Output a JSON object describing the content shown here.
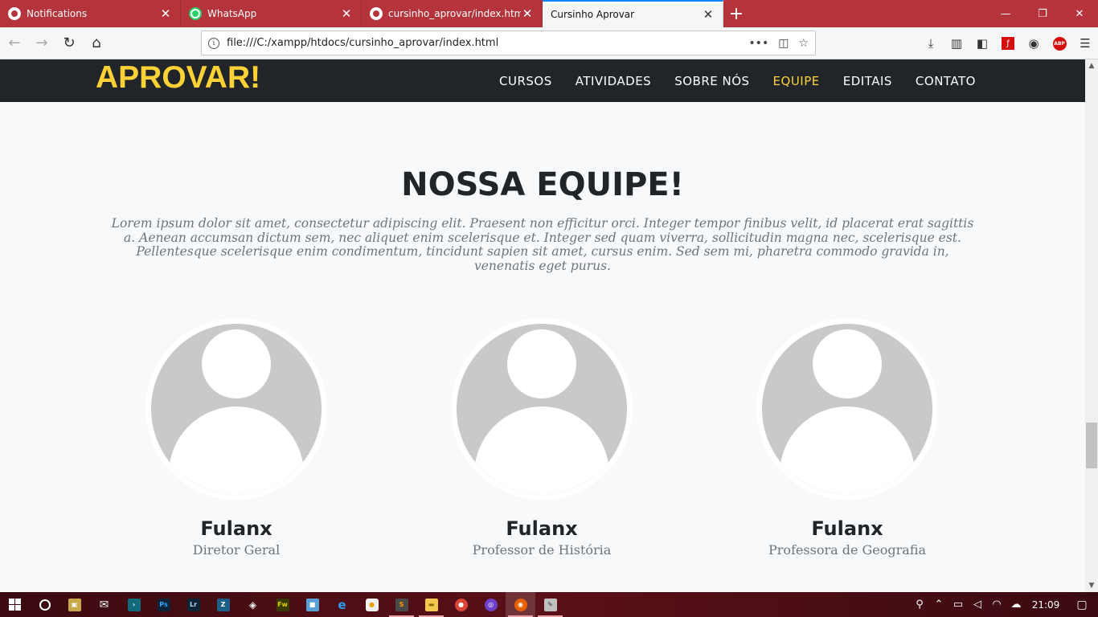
{
  "browser": {
    "tabs": [
      {
        "label": "Notifications",
        "icon": "github-icon",
        "active": false
      },
      {
        "label": "WhatsApp",
        "icon": "whatsapp-icon",
        "active": false
      },
      {
        "label": "cursinho_aprovar/index.html at",
        "icon": "github-icon",
        "active": false
      },
      {
        "label": "Cursinho Aprovar",
        "icon": "",
        "active": true
      }
    ],
    "url": "file:///C:/xampp/htdocs/cursinho_aprovar/index.html",
    "accent_color": "#b5333a"
  },
  "site": {
    "brand": "APROVAR!",
    "brand_color": "#fed136",
    "menu": [
      {
        "label": "CURSOS",
        "active": false
      },
      {
        "label": "ATIVIDADES",
        "active": false
      },
      {
        "label": "SOBRE NÓS",
        "active": false
      },
      {
        "label": "EQUIPE",
        "active": true
      },
      {
        "label": "EDITAIS",
        "active": false
      },
      {
        "label": "CONTATO",
        "active": false
      }
    ]
  },
  "team": {
    "heading": "NOSSA EQUIPE!",
    "subheading": "Lorem ipsum dolor sit amet, consectetur adipiscing elit. Praesent non efficitur orci. Integer tempor finibus velit, id placerat erat sagittis a. Aenean accumsan dictum sem, nec aliquet enim scelerisque et. Integer sed quam viverra, sollicitudin magna nec, scelerisque est. Pellentesque scelerisque enim condimentum, tincidunt sapien sit amet, cursus enim. Sed sem mi, pharetra commodo gravida in, venenatis eget purus.",
    "members": [
      {
        "name": "Fulanx",
        "role": "Diretor Geral"
      },
      {
        "name": "Fulanx",
        "role": "Professor de História"
      },
      {
        "name": "Fulanx",
        "role": "Professora de Geografia"
      }
    ]
  },
  "taskbar": {
    "apps": [
      "windows-start-icon",
      "cortana-icon",
      "store-icon",
      "mail-icon",
      "powershell-icon",
      "photoshop-icon",
      "lightroom-icon",
      "filezilla-icon",
      "unity-icon",
      "fireworks-icon",
      "virtualbox-icon",
      "edge-icon",
      "chrome-canary-icon",
      "sublime-icon",
      "file-explorer-icon",
      "chrome-icon",
      "github-desktop-icon",
      "firefox-icon",
      "paint-icon"
    ],
    "time": "21:09"
  }
}
